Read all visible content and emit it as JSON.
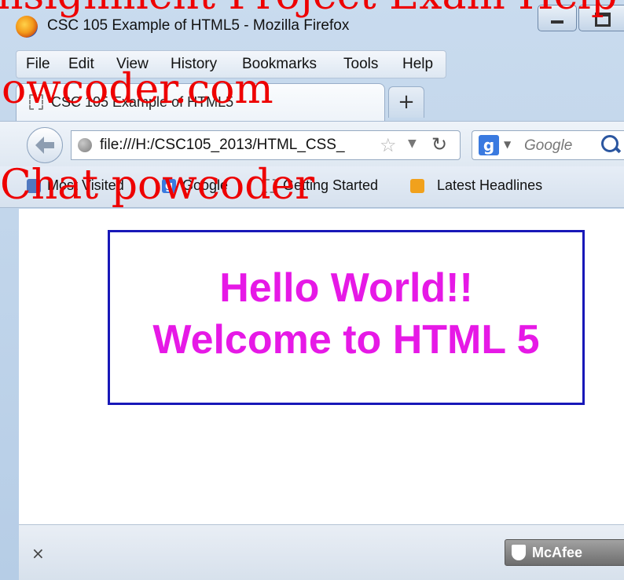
{
  "window": {
    "title": "CSC 105 Example of HTML5 - Mozilla Firefox"
  },
  "menubar": {
    "items": [
      {
        "label": "File"
      },
      {
        "label": "Edit"
      },
      {
        "label": "View"
      },
      {
        "label": "History"
      },
      {
        "label": "Bookmarks"
      },
      {
        "label": "Tools"
      },
      {
        "label": "Help"
      }
    ]
  },
  "tab": {
    "label": "CSC 105 Example of HTML5",
    "new_tab_symbol": "+"
  },
  "navbar": {
    "url": "file:///H:/CSC105_2013/HTML_CSS_",
    "search_placeholder": "Google",
    "search_engine_icon": "google-icon"
  },
  "bookmarks": [
    {
      "label": "Most Visited",
      "icon": "most-visited-icon"
    },
    {
      "label": "Google",
      "icon": "google-icon"
    },
    {
      "label": "Getting Started",
      "icon": "page-icon"
    },
    {
      "label": "Latest Headlines",
      "icon": "rss-icon"
    }
  ],
  "page": {
    "line1": "Hello World!!",
    "line2": "Welcome to HTML 5",
    "text_color": "#e619e6",
    "border_color": "#1818b8"
  },
  "statusbar": {
    "close_symbol": "×",
    "addon_label": "McAfee"
  },
  "watermark": {
    "line1": "owcoder.com",
    "line2": "Chat powcoder",
    "top_partial": "nsignment Project Exam Help",
    "color": "#ee0000"
  }
}
